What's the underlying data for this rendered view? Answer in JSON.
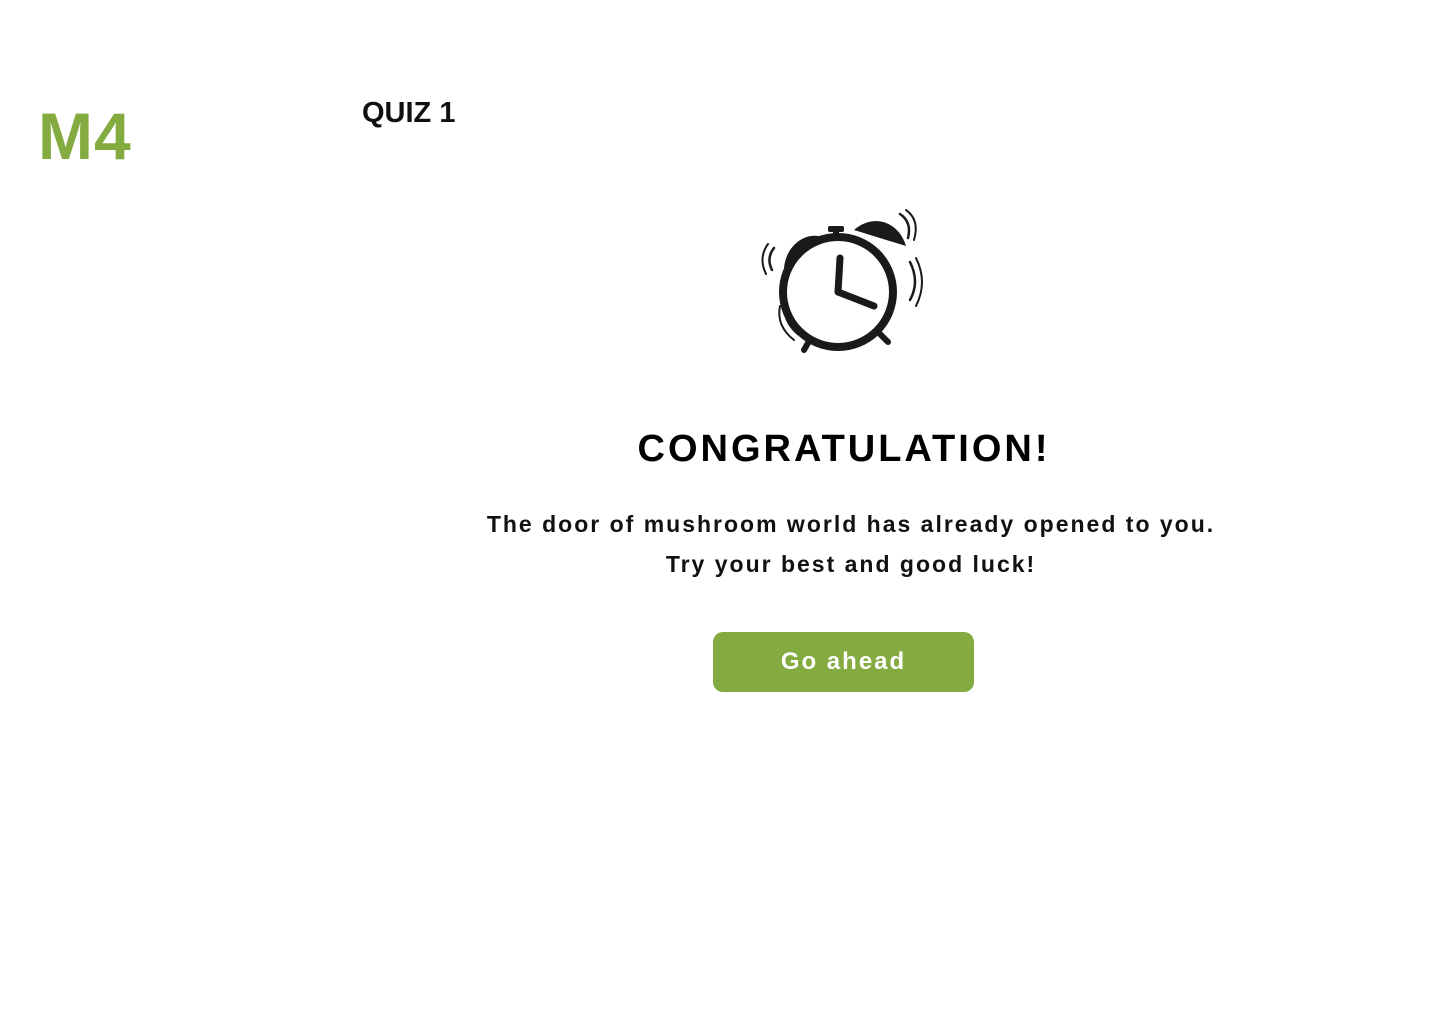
{
  "brand": {
    "logo_text": "M4",
    "accent_color": "#83ab3f"
  },
  "header": {
    "quiz_title": "QUIZ 1"
  },
  "main": {
    "icon": "alarm-clock-icon",
    "headline": "CONGRATULATION!",
    "message_lines": [
      "The door of mushroom world has already opened to you.",
      "Try your best and good luck!"
    ],
    "button_label": "Go ahead"
  }
}
